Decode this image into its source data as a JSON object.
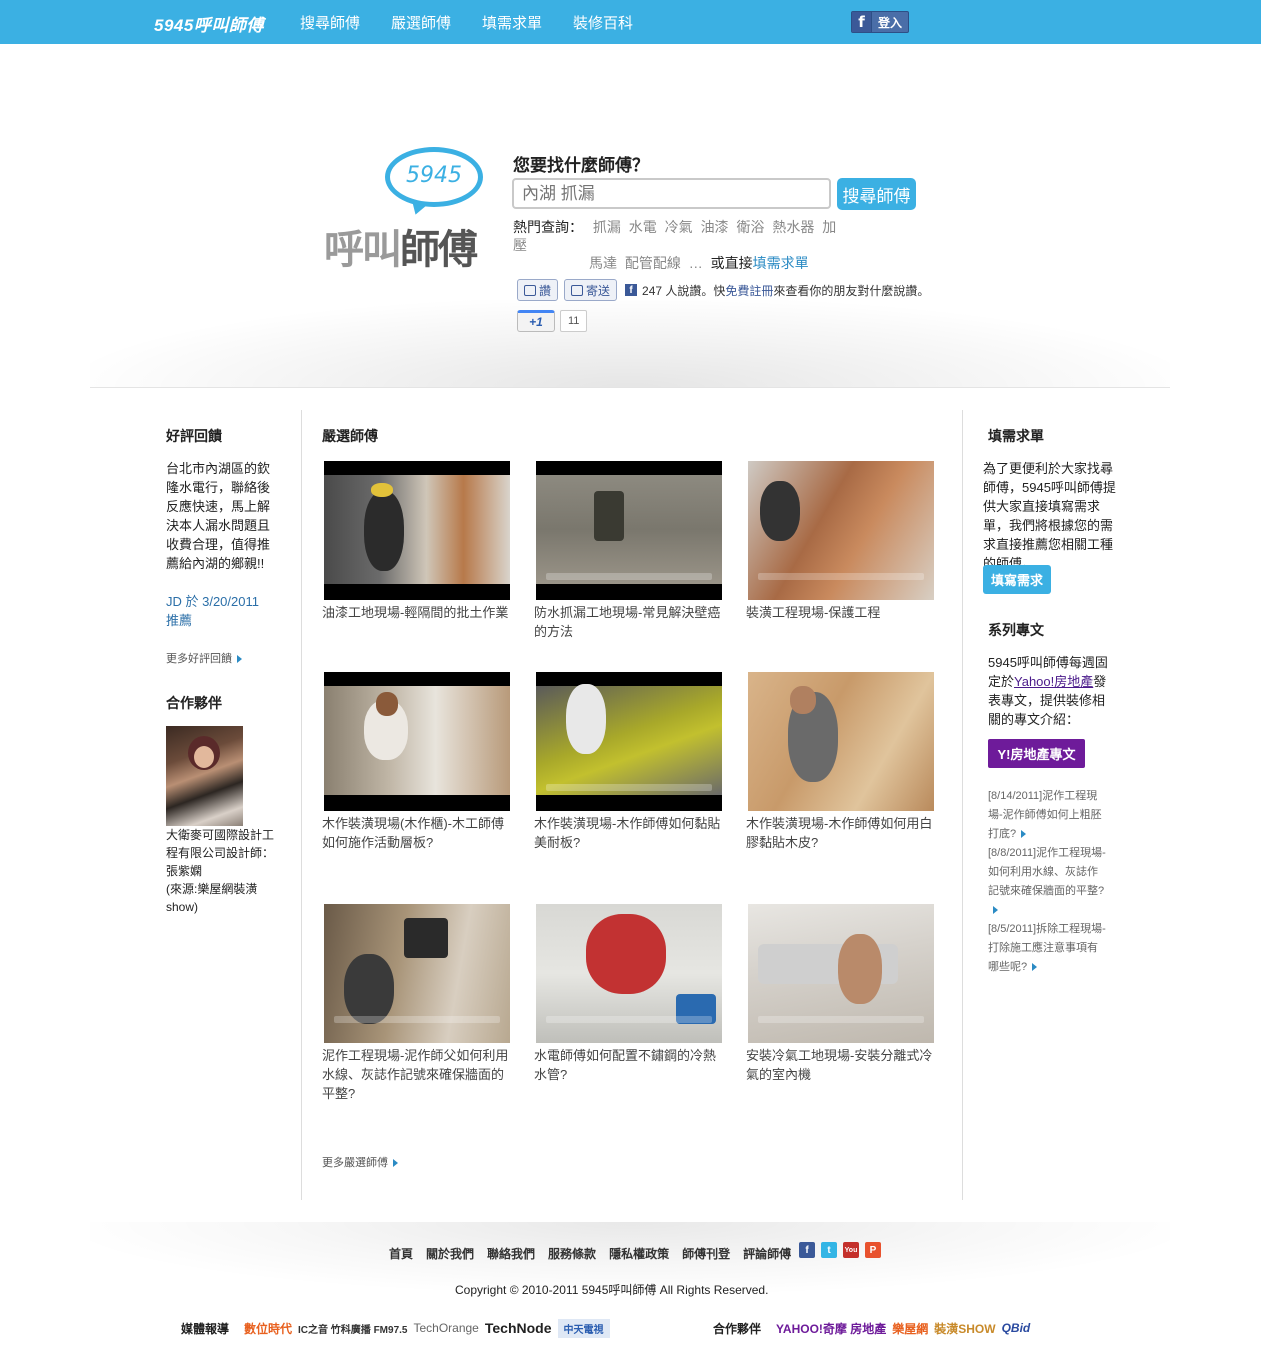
{
  "topbar": {
    "brand": "5945呼叫師傅",
    "nav": [
      "搜尋師傅",
      "嚴選師傅",
      "填需求單",
      "裝修百科"
    ],
    "login": "登入"
  },
  "hero": {
    "logo_number": "5945",
    "logo_text_light": "呼叫",
    "logo_text_bold": "師傅",
    "question": "您要找什麼師傅？",
    "search_placeholder": "內湖 抓漏",
    "search_button": "搜尋師傅",
    "hot_label": "熱門查詢：",
    "hot_items_line1": [
      "抓漏",
      "水電",
      "冷氣",
      "油漆",
      "衛浴",
      "熱水器",
      "加壓"
    ],
    "hot_items_line2": [
      "馬達",
      "配管配線"
    ],
    "hot_ellipsis": "…",
    "hot_or": "或直接",
    "hot_link": "填需求單",
    "like_button": "讚",
    "send_button": "寄送",
    "like_text_pre": "247 人說讚。快",
    "like_text_link": "免費註冊",
    "like_text_post": "來查看你的朋友對什麼說讚。",
    "plus_one": "+1",
    "plus_count": "11"
  },
  "left": {
    "reviews_title": "好評回饋",
    "review_text": "台北市內湖區的欽隆水電行，聯絡後反應快速，馬上解決本人漏水問題且收費合理，值得推薦給內湖的鄉親!!",
    "review_by": "JD 於 3/20/2011",
    "review_recommend": "推薦",
    "more_reviews": "更多好評回饋",
    "partner_title": "合作夥伴",
    "partner_caption": "大衛麥可國際設計工程有限公司設計師：張紫嫻",
    "partner_source": "(來源:樂屋網裝潢show)"
  },
  "center": {
    "title": "嚴選師傅",
    "videos": [
      "油漆工地現場-輕隔間的批土作業",
      "防水抓漏工地現場-常見解決壁癌的方法",
      "裝潢工程現場-保護工程",
      "木作裝潢現場(木作櫃)-木工師傅如何施作活動層板?",
      "木作裝潢現場-木作師傅如何黏貼美耐板?",
      "木作裝潢現場-木作師傅如何用白膠黏貼木皮?",
      "泥作工程現場-泥作師父如何利用水線、灰誌作記號來確保牆面的平整?",
      "水電師傅如何配置不鏽鋼的冷熱水管?",
      "安裝冷氣工地現場-安裝分離式冷氣的室內機"
    ],
    "more": "更多嚴選師傅"
  },
  "right": {
    "form_title": "填需求單",
    "form_text": "為了更便利於大家找尋師傅，5945呼叫師傅提供大家直接填寫需求單，我們將根據您的需求直接推薦您相關工種的師傅。",
    "form_button": "填寫需求",
    "column_title": "系列專文",
    "column_text_pre": "5945呼叫師傅每週固定於",
    "column_text_link": "Yahoo!房地產",
    "column_text_post": "發表專文，提供裝修相關的專文介紹：",
    "yahoo_button": "Y!房地產專文",
    "articles": [
      "[8/14/2011]泥作工程現場-泥作師傅如何上粗胚打底?",
      "[8/8/2011]泥作工程現場-如何利用水線、灰誌作記號來確保牆面的平整?",
      "[8/5/2011]拆除工程現場-打除施工應注意事項有哪些呢?"
    ]
  },
  "footer": {
    "links": [
      "首頁",
      "關於我們",
      "聯絡我們",
      "服務條款",
      "隱私權政策",
      "師傅刊登",
      "評論師傅"
    ],
    "social": [
      "facebook-icon",
      "twitter-icon",
      "youtube-icon",
      "plurk-icon"
    ],
    "copyright": "Copyright © 2010-2011 5945呼叫師傅 All Rights Reserved.",
    "media_label": "媒體報導",
    "media": [
      "數位時代",
      "IC之音 竹科廣播 FM97.5",
      "TechOrange",
      "TechNode",
      "中天電視"
    ],
    "partners_label": "合作夥伴",
    "partners": [
      "YAHOO!奇摩 房地產",
      "樂屋網",
      "裝潢SHOW",
      "QBid"
    ]
  },
  "colors": {
    "accent": "#3bb0e3",
    "link": "#2b8bc4",
    "yahoo": "#6e1b9a",
    "facebook": "#3b5998"
  }
}
